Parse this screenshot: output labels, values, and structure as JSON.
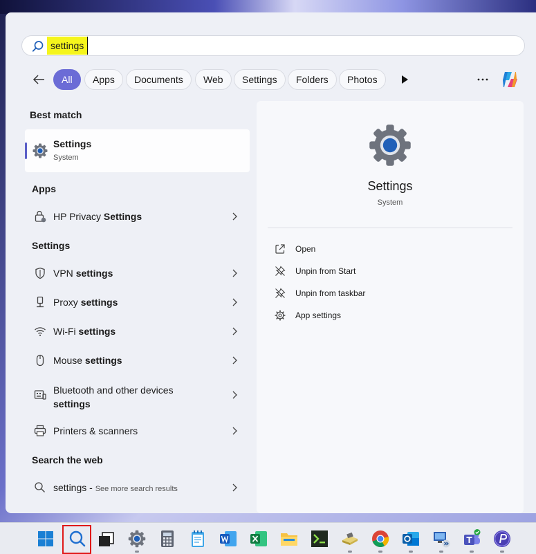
{
  "search": {
    "query": "settings"
  },
  "filters": [
    "All",
    "Apps",
    "Documents",
    "Web",
    "Settings",
    "Folders",
    "Photos"
  ],
  "sections": {
    "best_match": "Best match",
    "apps": "Apps",
    "settings": "Settings",
    "search_web": "Search the web"
  },
  "best_match": {
    "title": "Settings",
    "subtitle": "System"
  },
  "apps": [
    {
      "pre": "HP Privacy ",
      "bold": "Settings"
    }
  ],
  "settings_items": [
    {
      "pre": "VPN ",
      "bold": "settings"
    },
    {
      "pre": "Proxy ",
      "bold": "settings"
    },
    {
      "pre": "Wi-Fi ",
      "bold": "settings"
    },
    {
      "pre": "Mouse ",
      "bold": "settings"
    },
    {
      "pre": "Bluetooth and other devices",
      "bold": "settings"
    },
    {
      "pre": "Printers & scanners",
      "bold": ""
    }
  ],
  "web": {
    "query": "settings",
    "dash": " - ",
    "hint": "See more search results"
  },
  "detail": {
    "name": "Settings",
    "kind": "System",
    "actions": [
      "Open",
      "Unpin from Start",
      "Unpin from taskbar",
      "App settings"
    ]
  },
  "colors": {
    "accent": "#6b6cd6",
    "highlight": "#f5f51c",
    "focus_frame": "#e01919"
  },
  "taskbar_icons": [
    "windows-start-icon",
    "search-icon",
    "task-view-icon",
    "settings-icon",
    "calculator-icon",
    "notepad-icon",
    "word-icon",
    "excel-icon",
    "file-explorer-icon",
    "terminal-icon",
    "notes-app-icon",
    "chrome-icon",
    "outlook-icon",
    "remote-desktop-icon",
    "teams-icon",
    "p-app-icon"
  ]
}
